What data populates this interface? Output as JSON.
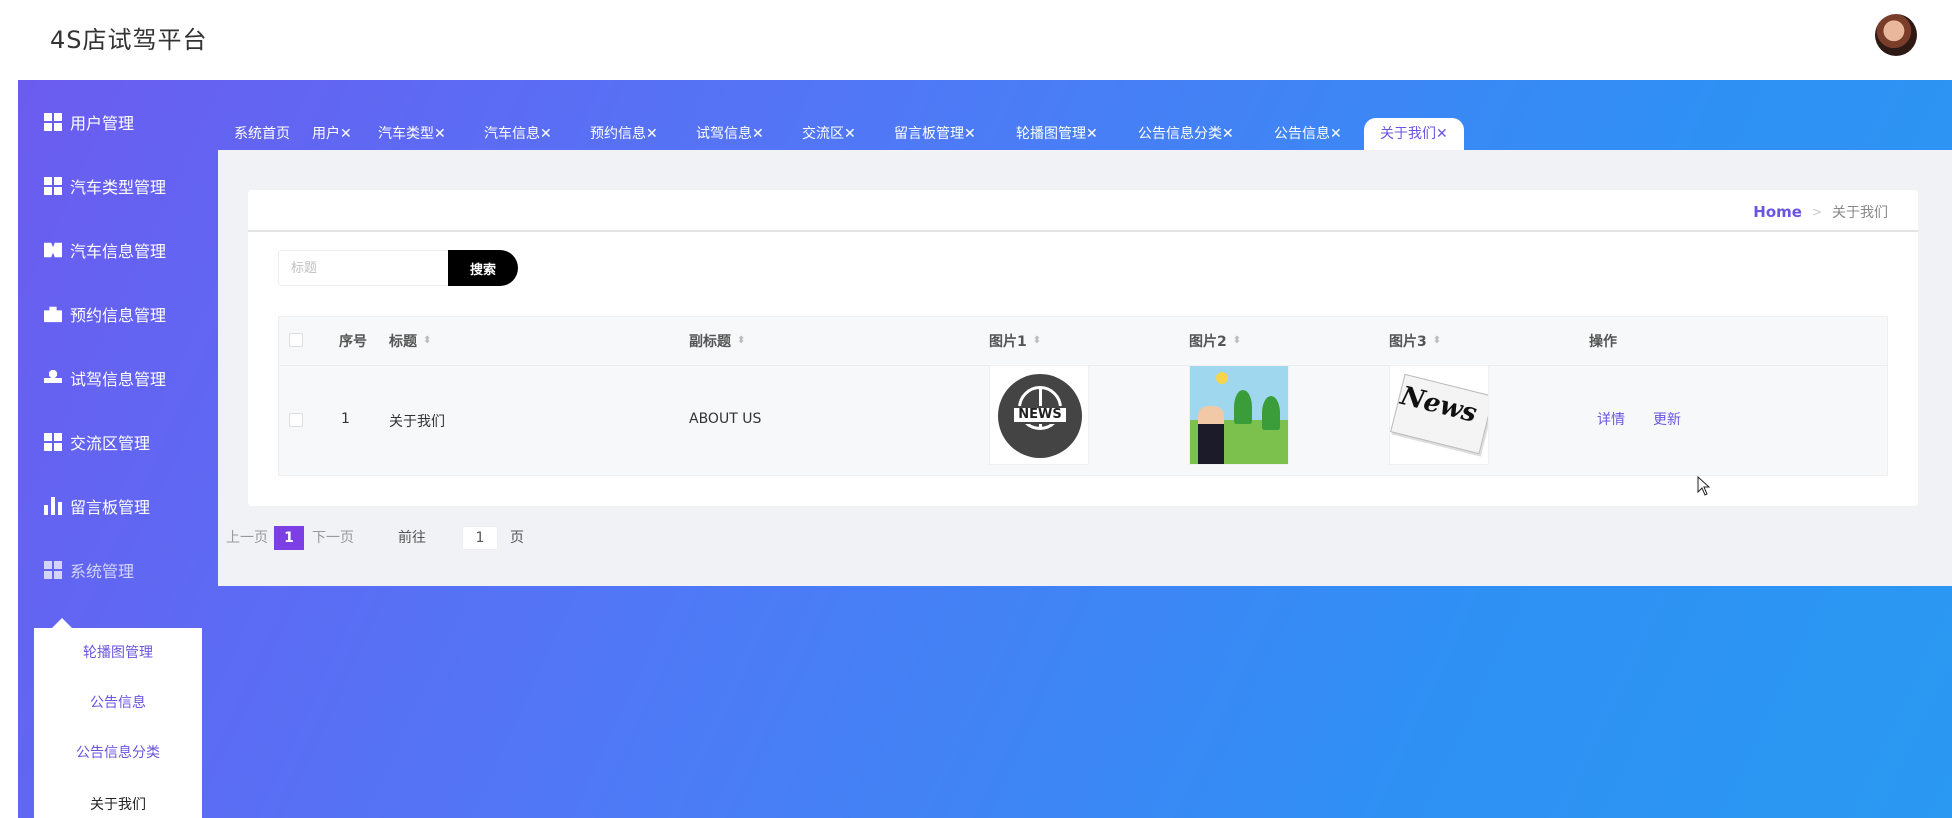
{
  "app": {
    "title": "4S店试驾平台"
  },
  "sidebar": {
    "items": [
      {
        "label": "用户管理",
        "icon": "grid-icon"
      },
      {
        "label": "汽车类型管理",
        "icon": "grid-icon"
      },
      {
        "label": "汽车信息管理",
        "icon": "ticket-icon"
      },
      {
        "label": "预约信息管理",
        "icon": "briefcase-icon"
      },
      {
        "label": "试驾信息管理",
        "icon": "user-icon"
      },
      {
        "label": "交流区管理",
        "icon": "grid-icon"
      },
      {
        "label": "留言板管理",
        "icon": "bar-chart-icon"
      },
      {
        "label": "系统管理",
        "icon": "grid-icon"
      }
    ],
    "submenu": [
      "轮播图管理",
      "公告信息",
      "公告信息分类",
      "关于我们"
    ]
  },
  "tabs": [
    "系统首页",
    "用户✕",
    "汽车类型✕",
    "汽车信息✕",
    "预约信息✕",
    "试驾信息✕",
    "交流区✕",
    "留言板管理✕",
    "轮播图管理✕",
    "公告信息分类✕",
    "公告信息✕",
    "关于我们✕"
  ],
  "breadcrumb": {
    "home": "Home",
    "separator": ">",
    "current": "关于我们"
  },
  "search": {
    "placeholder": "标题",
    "button": "搜索"
  },
  "table": {
    "columns": [
      "序号",
      "标题",
      "副标题",
      "图片1",
      "图片2",
      "图片3",
      "操作"
    ],
    "rows": [
      {
        "index": "1",
        "title": "关于我们",
        "subtitle": "ABOUT US",
        "image1": "NEWS",
        "image3": "News",
        "actions": [
          "详情",
          "更新"
        ]
      }
    ]
  },
  "pagination": {
    "prev": "上一页",
    "current": "1",
    "next": "下一页",
    "goto": "前往",
    "page_value": "1",
    "page_unit": "页"
  },
  "colors": {
    "accent": "#6a55e0",
    "gradient_start": "#6b5cf0",
    "gradient_end": "#2a99f2",
    "page_active": "#7b3fe4"
  }
}
